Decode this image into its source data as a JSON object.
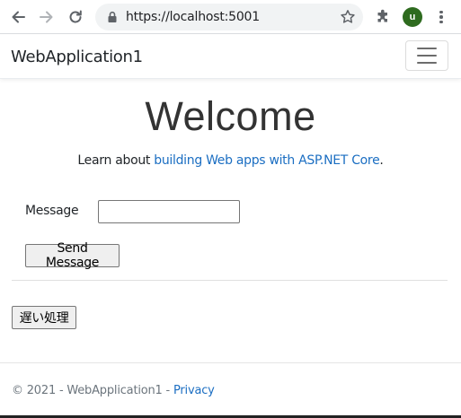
{
  "browser": {
    "url": "https://localhost:5001",
    "profile_initial": "u",
    "icons": {
      "back": "arrow-left-icon",
      "forward": "arrow-right-icon",
      "reload": "reload-icon",
      "lock": "lock-icon",
      "bookmark": "star-icon",
      "extensions": "puzzle-icon",
      "menu": "kebab-menu-icon"
    },
    "avatar_color": "#2e6b1f"
  },
  "navbar": {
    "brand": "WebApplication1",
    "toggler_icon": "hamburger-icon"
  },
  "main": {
    "heading": "Welcome",
    "learn_prefix": "Learn about ",
    "learn_link": "building Web apps with ASP.NET Core",
    "learn_suffix": ".",
    "message_label": "Message",
    "message_value": "",
    "send_button": "Send Message",
    "slow_button": "遅い処理"
  },
  "footer": {
    "copyright": "© 2021 - WebApplication1 - ",
    "privacy_link": "Privacy"
  },
  "colors": {
    "link": "#1b6ec2",
    "muted": "#6c757d"
  }
}
